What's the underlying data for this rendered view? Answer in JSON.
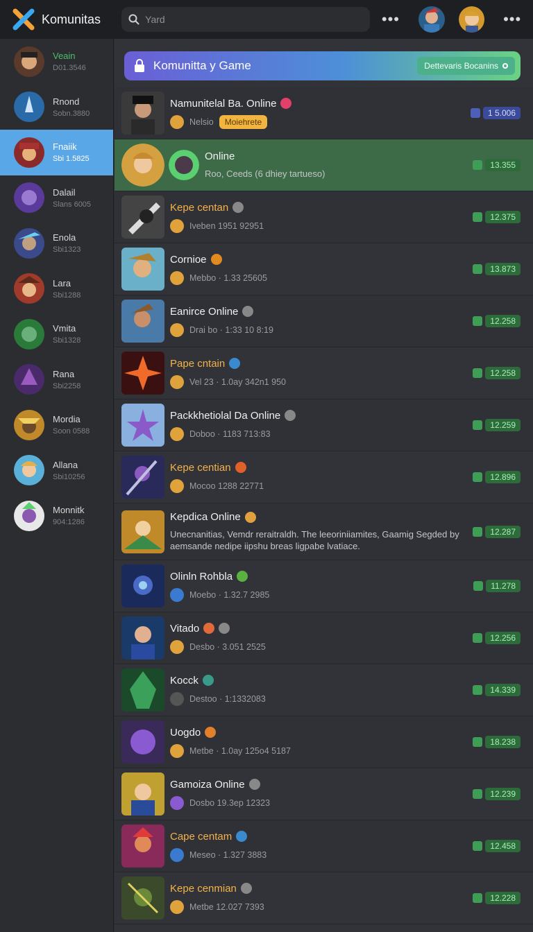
{
  "app": {
    "name": "Komunitas"
  },
  "search": {
    "placeholder": "Yard"
  },
  "sidebar": {
    "items": [
      {
        "name": "Veain",
        "sub": "D01.3546"
      },
      {
        "name": "Rnond",
        "sub": "Sobn.3880"
      },
      {
        "name": "Fnaiik",
        "sub": "Sbi 1.5825"
      },
      {
        "name": "Dalail",
        "sub": "Slans 6005"
      },
      {
        "name": "Enola",
        "sub": "Sbi1323"
      },
      {
        "name": "Lara",
        "sub": "Sbi1288"
      },
      {
        "name": "Vmita",
        "sub": "Sbi1328"
      },
      {
        "name": "Rana",
        "sub": "Sbi2258"
      },
      {
        "name": "Mordia",
        "sub": "Soon 0588"
      },
      {
        "name": "Allana",
        "sub": "Sbi10256"
      },
      {
        "name": "Monnitk",
        "sub": "904:1286"
      }
    ]
  },
  "banner": {
    "title": "Komunitta y Game",
    "button": "Dettevaris Bocanins"
  },
  "rows": [
    {
      "title": "Namunitelal Ba. Online",
      "meta": "Nelsio",
      "pill": "Moiehrete",
      "count": "1 5.006",
      "style": "blue"
    },
    {
      "title": "Online",
      "desc": "Roo, Ceeds (6 dhiey tartueso)",
      "count": "13.355",
      "highlight": true
    },
    {
      "title": "Kepe centan",
      "meta": "Iveben 1951 92951",
      "count": "12.375",
      "orange": true
    },
    {
      "title": "Cornioe",
      "meta": "Mebbo · 1.33 25605",
      "count": "13.873"
    },
    {
      "title": "Eanirce Online",
      "meta": "Drai bo · 1:33 10 8:19",
      "count": "12.258"
    },
    {
      "title": "Pape cntain",
      "meta": "Vel 23 · 1.0ay 342n1 950",
      "count": "12.258",
      "orange": true
    },
    {
      "title": "Packkhetiolal Da Online",
      "meta": "Doboo · 1183 713:83",
      "count": "12.259"
    },
    {
      "title": "Kepe centian",
      "meta": "Mocoo 1288 22771",
      "count": "12.896",
      "orange": true
    },
    {
      "title": "Kepdica Online",
      "desc": "Unecnanitias, Vemdr reraitraldh. The leeoriniiamites, Gaamig Segded by aemsande nedipe iipshu breas ligpabe lvatiace.",
      "count": "12.287",
      "tall": true
    },
    {
      "title": "Olinln Rohbla",
      "meta": "Moebo · 1.32.7 2985",
      "count": "11.278"
    },
    {
      "title": "Vitado",
      "meta": "Desbo · 3.051 2525",
      "count": "12.256"
    },
    {
      "title": "Kocck",
      "meta": "Destoo · 1:1332083",
      "count": "14.339"
    },
    {
      "title": "Uogdo",
      "meta": "Metbe · 1.0ay 125o4 5187",
      "count": "18.238"
    },
    {
      "title": "Gamoiza Online",
      "meta": "Dosbo 19.3ep 12323",
      "count": "12.239"
    },
    {
      "title": "Cape centam",
      "meta": "Meseo · 1.327 3883",
      "count": "12.458",
      "orange": true
    },
    {
      "title": "Kepe cenmian",
      "meta": "Metbe 12.027 7393",
      "count": "12.228",
      "orange": true
    }
  ],
  "icons": {
    "logo": "x-logo-icon",
    "search": "search-icon",
    "more": "more-dots-icon"
  },
  "colors": {
    "accent": "#5aa7e8",
    "highlight": "#3d6b47",
    "count_green": "#2e6b3b",
    "count_blue": "#3b4a99",
    "orange_title": "#f5b24a"
  }
}
